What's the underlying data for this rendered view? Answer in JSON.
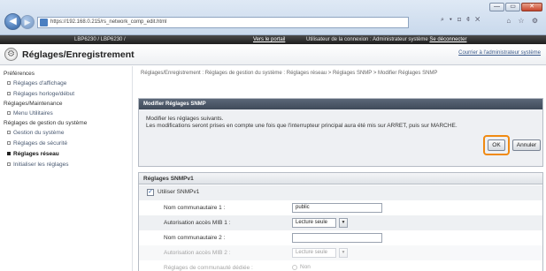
{
  "browser": {
    "url": "https://192.168.0.215/rs_network_comp_edit.html",
    "window_controls": [
      "—",
      "▭",
      "✕"
    ],
    "addr_tools": "⌕ ▾ ⊡ ¢ ✕",
    "right_tools": "⌂ ☆ ⚙"
  },
  "topbar": {
    "model": "LBP6230 / LBP6230 /",
    "portal": "Vers le portail",
    "user_info": "Utilisateur de la connexion : Administrateur système",
    "logout": "Se déconnecter"
  },
  "header": {
    "title": "Réglages/Enregistrement",
    "goto_admin": "Courrier à l'administrateur système"
  },
  "sidebar": {
    "sections": [
      {
        "heading": "Préférences",
        "items": [
          {
            "label": "Réglages d'affichage",
            "active": false
          },
          {
            "label": "Réglages horloge/début",
            "active": false
          }
        ]
      },
      {
        "heading": "Réglages/Maintenance",
        "items": [
          {
            "label": "Menu Utilitaires",
            "active": false
          }
        ]
      },
      {
        "heading": "Réglages de gestion du système",
        "items": [
          {
            "label": "Gestion du système",
            "active": false
          },
          {
            "label": "Réglages de sécurité",
            "active": false
          },
          {
            "label": "Réglages réseau",
            "active": true
          },
          {
            "label": "Initialiser les réglages",
            "active": false
          }
        ]
      }
    ]
  },
  "main": {
    "breadcrumb": "Réglages/Enregistrement : Réglages de gestion du système : Réglages réseau > Réglages SNMP > Modifier Réglages SNMP",
    "modify_box": {
      "heading": "Modifier Réglages SNMP",
      "line1": "Modifier les réglages suivants.",
      "line2": "Les modifications seront prises en compte une fois que l'interrupteur principal aura été mis sur ARRET, puis sur MARCHE.",
      "ok": "OK",
      "cancel": "Annuler"
    },
    "snmp_v1": {
      "heading": "Réglages SNMPv1",
      "use_label": "Utiliser SNMPv1",
      "use_checked": "✓",
      "community1_label": "Nom communautaire 1 :",
      "community1_value": "public",
      "mib1_label": "Autorisation accès MIB 1 :",
      "mib1_value": "Lecture seule",
      "community2_label": "Nom communautaire 2 :",
      "community2_value": "",
      "mib2_label": "Autorisation accès MIB 2 :",
      "mib2_value": "Lecture seule",
      "dedicated_label": "Réglages de communauté dédiée :",
      "dedicated_value": "Non"
    }
  }
}
